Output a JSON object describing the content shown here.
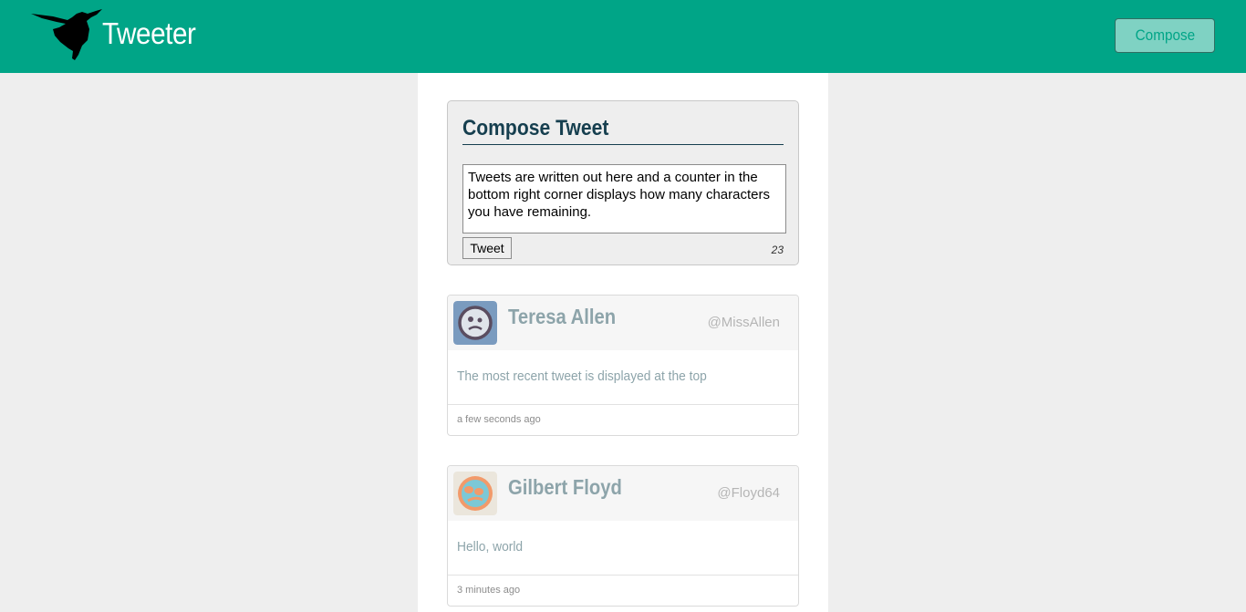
{
  "nav": {
    "brand": "Tweeter",
    "compose_label": "Compose"
  },
  "composer": {
    "title": "Compose Tweet",
    "text": "Tweets are written out here and a counter in the bottom right corner displays how many characters you have remaining.",
    "submit_label": "Tweet",
    "counter": "23"
  },
  "tweets": [
    {
      "name": "Teresa Allen",
      "handle": "@MissAllen",
      "content": "The most recent tweet is displayed at the top",
      "time": "a few seconds ago",
      "avatar": "face-avatar"
    },
    {
      "name": "Gilbert Floyd",
      "handle": "@Floyd64",
      "content": "Hello, world",
      "time": "3 minutes ago",
      "avatar": "face-avatar"
    }
  ],
  "colors": {
    "brand": "#00a587",
    "title": "#163f4f",
    "muted": "#8da4aa"
  }
}
